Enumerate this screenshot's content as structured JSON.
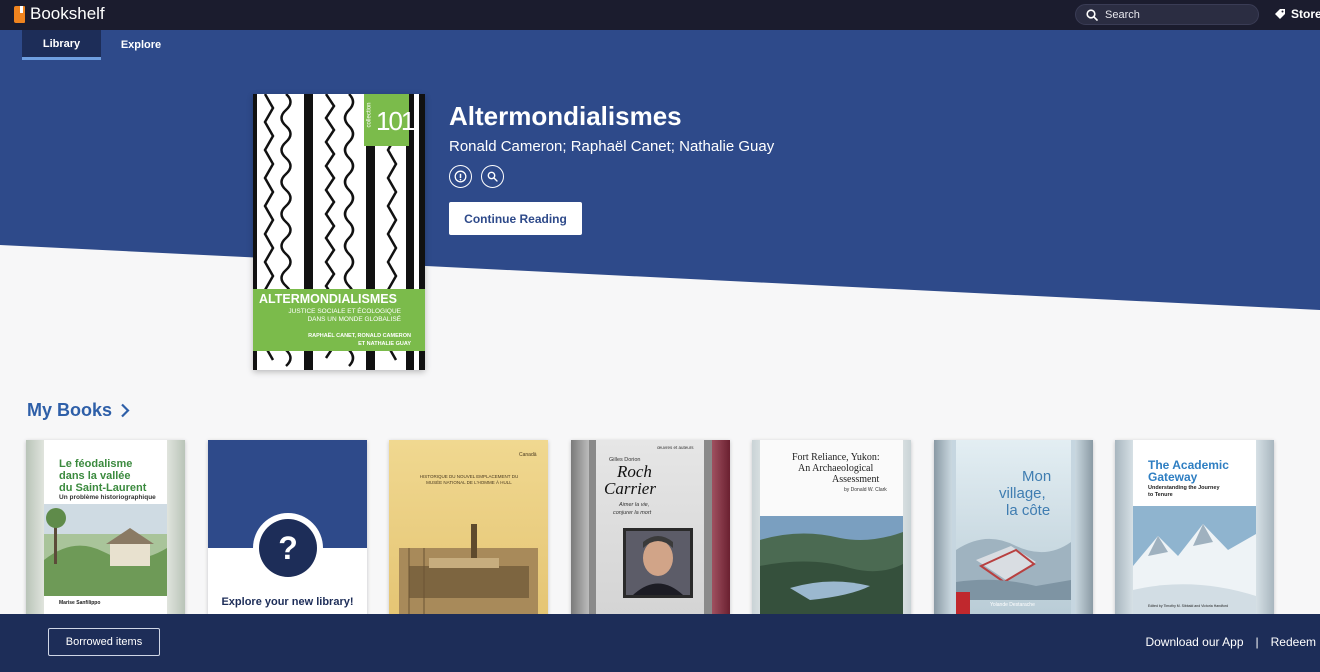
{
  "app": {
    "title": "Bookshelf"
  },
  "search": {
    "placeholder": "Search"
  },
  "store": {
    "label": "Store"
  },
  "nav": {
    "tabs": [
      {
        "label": "Library",
        "active": true
      },
      {
        "label": "Explore",
        "active": false
      }
    ]
  },
  "hero": {
    "title": "Altermondialismes",
    "authors": "Ronald Cameron; Raphaël Canet; Nathalie Guay",
    "continue_label": "Continue Reading",
    "cover": {
      "series": "collection",
      "number": "101",
      "title": "ALTERMONDIALISMES",
      "subtitle_line1": "JUSTICE SOCIALE ET ÉCOLOGIQUE",
      "subtitle_line2": "DANS UN MONDE GLOBALISÉ",
      "authors_line1": "RAPHAËL CANET, RONALD CAMERON",
      "authors_line2": "ET NATHALIE GUAY"
    }
  },
  "my_books": {
    "heading": "My Books",
    "books": [
      {
        "title_l1": "Le féodalisme",
        "title_l2": "dans la vallée",
        "title_l3": "du Saint-Laurent",
        "subtitle": "Un problème historiographique",
        "author": "Marise Sanfilippo"
      },
      {
        "explore_label": "Explore your new library!"
      },
      {
        "title": "HISTORIQUE DU NOUVEL EMPLACEMENT DU MUSÉE NATIONAL DE L'HOMME À HULL",
        "brand": "Canadä"
      },
      {
        "series": "œuvres et auteurs",
        "author": "Gilles Dorion",
        "title_l1": "Roch",
        "title_l2": "Carrier",
        "tagline_l1": "Aimer la vie,",
        "tagline_l2": "conjurer la mort"
      },
      {
        "title_l1": "Fort Reliance, Yukon:",
        "title_l2": "An Archaeological",
        "title_l3": "Assessment",
        "author": "by Donald W. Clark"
      },
      {
        "title_l1": "Mon",
        "title_l2": "village,",
        "title_l3": "la côte",
        "author": "Yolande Destarache"
      },
      {
        "title_l1": "The Academic",
        "title_l2": "Gateway",
        "subtitle_l1": "Understanding the Journey",
        "subtitle_l2": "to Tenure",
        "editors": "Edited by Timothy M. Sibbald and Victoria Handford"
      }
    ]
  },
  "footer": {
    "borrowed_label": "Borrowed items",
    "download_label": "Download our App",
    "separator": "|",
    "redeem_label": "Redeem"
  },
  "colors": {
    "topbar": "#1b1c2e",
    "nav": "#2e4a8a",
    "hero": "#2e4a8a",
    "footer": "#1d2d58",
    "accent_link": "#2e5fa8"
  }
}
